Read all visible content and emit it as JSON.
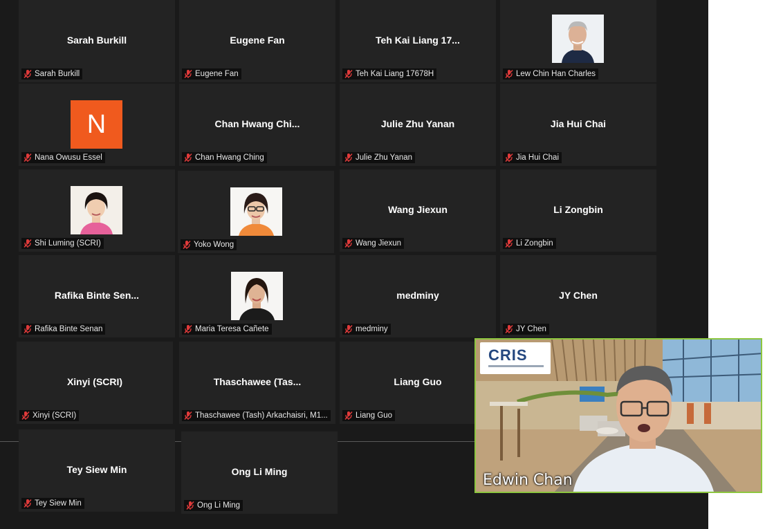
{
  "participants": [
    {
      "display": "Sarah Burkill",
      "label": "Sarah Burkill"
    },
    {
      "display": "Eugene Fan",
      "label": "Eugene Fan"
    },
    {
      "display": "Teh Kai Liang 17...",
      "label": "Teh Kai Liang 17678H"
    },
    {
      "display": "",
      "label": "Lew Chin Han Charles"
    },
    {
      "display": "",
      "label": "Nana Owusu Essel",
      "avatar_letter": "N"
    },
    {
      "display": "Chan Hwang Chi...",
      "label": "Chan Hwang Ching"
    },
    {
      "display": "Julie Zhu Yanan",
      "label": "Julie Zhu Yanan"
    },
    {
      "display": "Jia Hui Chai",
      "label": "Jia Hui Chai"
    },
    {
      "display": "",
      "label": "Shi Luming (SCRI)"
    },
    {
      "display": "",
      "label": "Yoko Wong"
    },
    {
      "display": "Wang Jiexun",
      "label": "Wang Jiexun"
    },
    {
      "display": "Li Zongbin",
      "label": "Li Zongbin"
    },
    {
      "display": "Rafika Binte Sen...",
      "label": "Rafika Binte Senan"
    },
    {
      "display": "",
      "label": "Maria Teresa Cañete"
    },
    {
      "display": "medminy",
      "label": "medminy"
    },
    {
      "display": "JY Chen",
      "label": "JY Chen"
    },
    {
      "display": "Xinyi (SCRI)",
      "label": "Xinyi (SCRI)"
    },
    {
      "display": "Thaschawee (Tas...",
      "label": "Thaschawee (Tash) Arkachaisri, M1..."
    },
    {
      "display": "Liang Guo",
      "label": "Liang Guo"
    },
    {
      "display": "Tey Siew Min",
      "label": "Tey Siew Min"
    },
    {
      "display": "Ong Li Ming",
      "label": "Ong Li Ming"
    }
  ],
  "active_speaker": {
    "name": "Edwin Chan",
    "logo_text": "CRIS",
    "border_color": "#8dc63f"
  },
  "colors": {
    "grid_background": "#1a1a1a",
    "tile_background": "#232323",
    "muted_icon": "#e03a3a",
    "avatar_n": "#f05a1e"
  },
  "icons": {
    "mute": "muted-microphone-icon"
  }
}
